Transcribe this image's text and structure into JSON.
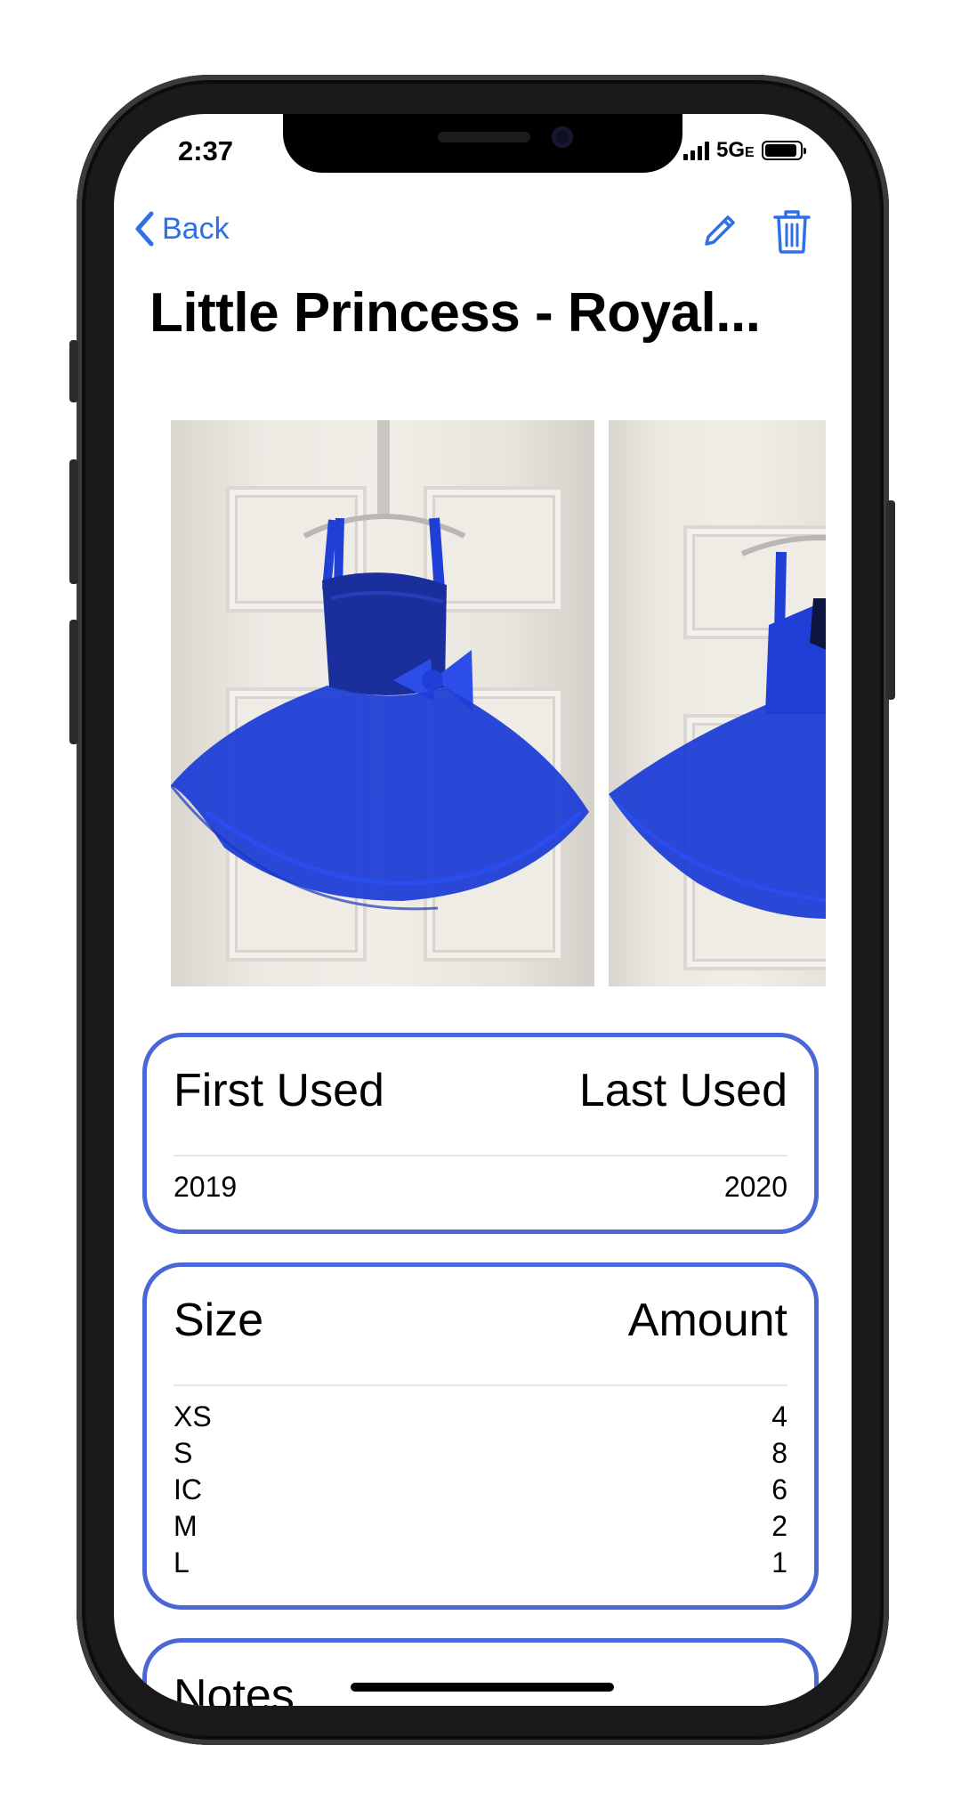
{
  "status_bar": {
    "time": "2:37",
    "network": "5G",
    "network_suffix": "E"
  },
  "nav": {
    "back_label": "Back",
    "edit_icon": "pencil-icon",
    "delete_icon": "trash-icon"
  },
  "page_title": "Little Princess - Royal...",
  "colors": {
    "accent": "#2f6fe8",
    "card_border": "#4a67d6",
    "dress_blue": "#1f3fd6"
  },
  "dates_card": {
    "first_header": "First Used",
    "last_header": "Last Used",
    "first_value": "2019",
    "last_value": "2020"
  },
  "sizes_card": {
    "size_header": "Size",
    "amount_header": "Amount",
    "rows": [
      {
        "size": "XS",
        "amount": "4"
      },
      {
        "size": "S",
        "amount": "8"
      },
      {
        "size": "IC",
        "amount": "6"
      },
      {
        "size": "M",
        "amount": "2"
      },
      {
        "size": "L",
        "amount": "1"
      }
    ]
  },
  "notes_card": {
    "header": "Notes"
  }
}
